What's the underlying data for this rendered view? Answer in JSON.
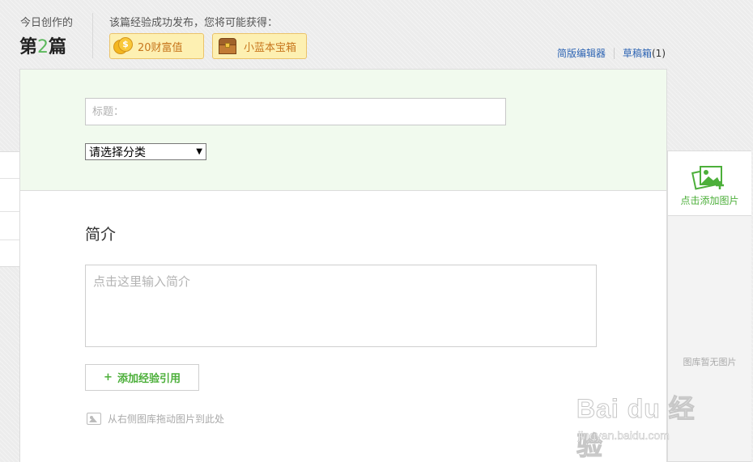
{
  "header": {
    "today_label": "今日创作的",
    "count_prefix": "第",
    "count_number": "2",
    "count_suffix": "篇",
    "reward_text": "该篇经验成功发布，您将可能获得：",
    "reward_wealth": "20财富值",
    "reward_box": "小蓝本宝箱",
    "link_simple_editor": "简版编辑器",
    "link_drafts": "草稿箱",
    "drafts_count": "(1)"
  },
  "editor": {
    "title_placeholder": "标题：",
    "category_selected": "请选择分类",
    "intro_heading": "简介",
    "intro_placeholder": "点击这里输入简介",
    "add_reference_plus": "+",
    "add_reference": "添加经验引用",
    "drag_hint": "从右侧图库拖动图片到此处"
  },
  "gallery": {
    "add_image": "点击添加图片",
    "empty": "图库暂无图片"
  },
  "watermark": {
    "main": "Bai du 经验",
    "sub": "jingyan.baidu.com"
  },
  "colors": {
    "accent_green": "#4caf3a",
    "link_blue": "#2d64b3",
    "badge_bg": "#fdf0b2",
    "header_zone_bg": "#f1faee"
  },
  "icons": {
    "coin": "coin-icon",
    "chest": "treasure-chest-icon",
    "add_picture": "add-picture-icon",
    "picture": "picture-icon",
    "dropdown": "dropdown-arrow-icon"
  }
}
